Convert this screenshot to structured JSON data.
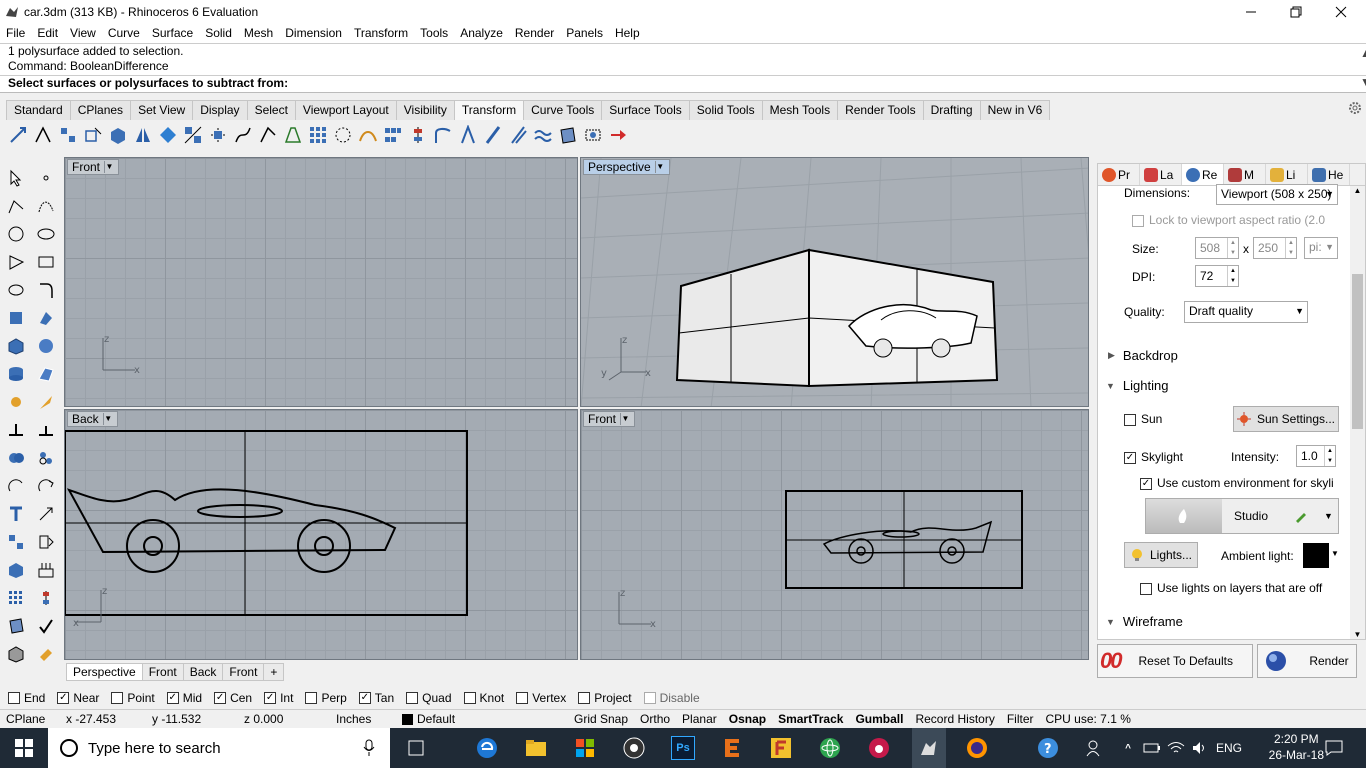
{
  "window": {
    "title": "car.3dm (313 KB) - Rhinoceros 6 Evaluation"
  },
  "menu": [
    "File",
    "Edit",
    "View",
    "Curve",
    "Surface",
    "Solid",
    "Mesh",
    "Dimension",
    "Transform",
    "Tools",
    "Analyze",
    "Render",
    "Panels",
    "Help"
  ],
  "command": {
    "history": [
      "1 polysurface added to selection.",
      "Command: BooleanDifference"
    ],
    "prompt": "Select surfaces or polysurfaces to subtract from:"
  },
  "toolbar_tabs": [
    "Standard",
    "CPlanes",
    "Set View",
    "Display",
    "Select",
    "Viewport Layout",
    "Visibility",
    "Transform",
    "Curve Tools",
    "Surface Tools",
    "Solid Tools",
    "Mesh Tools",
    "Render Tools",
    "Drafting",
    "New in V6"
  ],
  "active_toolbar_tab": "Transform",
  "viewports": {
    "top_left": "Front",
    "top_right": "Perspective",
    "bottom_left": "Back",
    "bottom_right": "Front"
  },
  "axis_labels": {
    "x": "x",
    "y": "y",
    "z": "z"
  },
  "viewport_tabs": [
    "Perspective",
    "Front",
    "Back",
    "Front"
  ],
  "viewport_tab_add": "+",
  "panel": {
    "tabs": [
      {
        "label": "Pr",
        "icon": "properties-icon",
        "color": "#e0562a"
      },
      {
        "label": "La",
        "icon": "layers-icon",
        "color": "#d04040"
      },
      {
        "label": "Re",
        "icon": "rendering-icon",
        "color": "#3b6fb5"
      },
      {
        "label": "M",
        "icon": "materials-icon",
        "color": "#b03b3b"
      },
      {
        "label": "Li",
        "icon": "libraries-icon",
        "color": "#e3b13b"
      },
      {
        "label": "He",
        "icon": "help-icon",
        "color": "#3f6fae"
      }
    ],
    "dimensions_label": "Dimensions:",
    "dimensions_value": "Viewport (508 x 250)",
    "lock_aspect": "Lock to viewport aspect ratio (2.0",
    "size_label": "Size:",
    "size_w": "508",
    "size_x": "x",
    "size_h": "250",
    "size_unit": "pi:",
    "dpi_label": "DPI:",
    "dpi_value": "72",
    "quality_label": "Quality:",
    "quality_value": "Draft quality",
    "backdrop": "Backdrop",
    "lighting": "Lighting",
    "sun": "Sun",
    "sun_settings": "Sun Settings...",
    "skylight": "Skylight",
    "intensity_label": "Intensity:",
    "intensity_value": "1.0",
    "custom_env": "Use custom environment for skyli",
    "environment": "Studio",
    "lights_button": "Lights...",
    "ambient_label": "Ambient light:",
    "ambient_color": "#000000",
    "lights_off_layers": "Use lights on layers that are off",
    "wireframe": "Wireframe",
    "reset_button": "Reset To Defaults",
    "render_button": "Render"
  },
  "osnaps": [
    {
      "label": "End",
      "checked": false
    },
    {
      "label": "Near",
      "checked": true
    },
    {
      "label": "Point",
      "checked": false
    },
    {
      "label": "Mid",
      "checked": true
    },
    {
      "label": "Cen",
      "checked": true
    },
    {
      "label": "Int",
      "checked": true
    },
    {
      "label": "Perp",
      "checked": false
    },
    {
      "label": "Tan",
      "checked": true
    },
    {
      "label": "Quad",
      "checked": false
    },
    {
      "label": "Knot",
      "checked": false
    },
    {
      "label": "Vertex",
      "checked": false
    },
    {
      "label": "Project",
      "checked": false
    },
    {
      "label": "Disable",
      "checked": false
    }
  ],
  "status": {
    "cplane": "CPlane",
    "x": "x -27.453",
    "y": "y -11.532",
    "z": "z 0.000",
    "units": "Inches",
    "layer": "Default",
    "grid_snap": "Grid Snap",
    "ortho": "Ortho",
    "planar": "Planar",
    "osnap": "Osnap",
    "smarttrack": "SmartTrack",
    "gumball": "Gumball",
    "record_history": "Record History",
    "filter": "Filter",
    "cpu": "CPU use: 7.1 %"
  },
  "taskbar": {
    "search_placeholder": "Type here to search",
    "time": "2:20 PM",
    "date": "26-Mar-18",
    "language": "ENG",
    "ps_label": "Ps"
  }
}
